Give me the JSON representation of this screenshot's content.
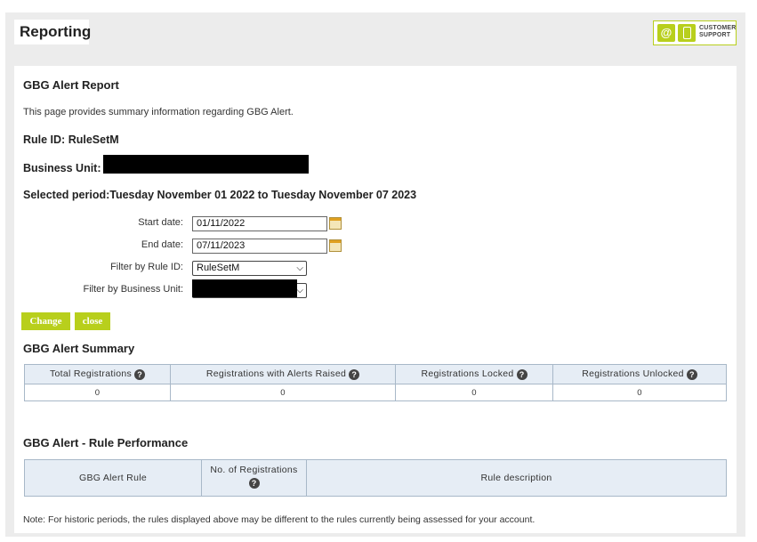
{
  "header": {
    "title": "Reporting",
    "support_line1": "CUSTOMER",
    "support_line2": "SUPPORT"
  },
  "report": {
    "title": "GBG Alert Report",
    "intro": "This page provides summary information regarding GBG Alert.",
    "rule_id": "Rule ID: RuleSetM",
    "business_unit_label": "Business Unit:",
    "selected_period": "Selected period:Tuesday November 01 2022 to Tuesday November 07 2023"
  },
  "form": {
    "start_label": "Start date:",
    "start_value": "01/11/2022",
    "end_label": "End date:",
    "end_value": "07/11/2023",
    "rule_label": "Filter by Rule ID:",
    "rule_value": "RuleSetM",
    "bu_label": "Filter by Business Unit:",
    "change_btn": "Change",
    "close_btn": "close"
  },
  "summary": {
    "title": "GBG Alert Summary",
    "columns": [
      "Total Registrations",
      "Registrations with Alerts Raised",
      "Registrations Locked",
      "Registrations Unlocked"
    ],
    "values": [
      "0",
      "0",
      "0",
      "0"
    ]
  },
  "performance": {
    "title": "GBG Alert - Rule Performance",
    "columns": [
      "GBG Alert Rule",
      "No. of Registrations",
      "Rule description"
    ]
  },
  "note": "Note: For historic periods, the rules displayed above may be different to the rules currently being assessed for your account."
}
